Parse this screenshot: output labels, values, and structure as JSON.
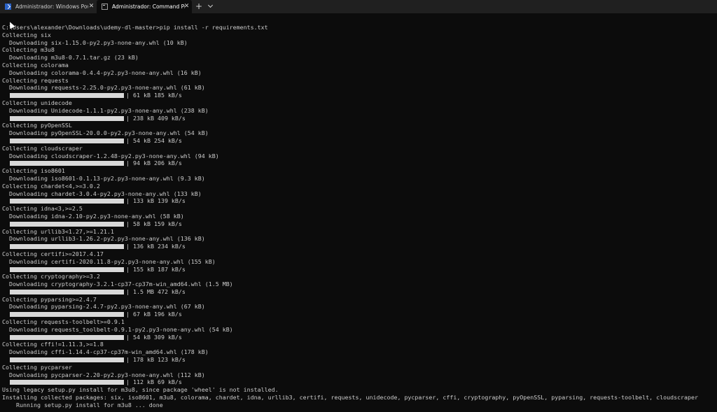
{
  "tabs": [
    {
      "label": "Administrador: Windows Power",
      "close": "✕",
      "icon": "powershell-icon"
    },
    {
      "label": "Administrador: Command Prom",
      "close": "✕",
      "icon": "command-prompt-icon"
    }
  ],
  "new_tab": "+",
  "colors": {
    "background": "#0c0c0c",
    "text": "#cccccc",
    "progress": "#d8d8d8",
    "tabbar": "#202020"
  },
  "console": {
    "lines": [
      {
        "text": "C:\\Users\\alexander\\Downloads\\udemy-dl-master>pip install -r requirements.txt"
      },
      {
        "text": "Collecting six"
      },
      {
        "text": "  Downloading six-1.15.0-py2.py3-none-any.whl (10 kB)"
      },
      {
        "text": "Collecting m3u8"
      },
      {
        "text": "  Downloading m3u8-0.7.1.tar.gz (23 kB)"
      },
      {
        "text": "Collecting colorama"
      },
      {
        "text": "  Downloading colorama-0.4.4-py2.py3-none-any.whl (16 kB)"
      },
      {
        "text": "Collecting requests"
      },
      {
        "text": "  Downloading requests-2.25.0-py2.py3-none-any.whl (61 kB)"
      },
      {
        "progress": "| 61 kB 185 kB/s"
      },
      {
        "text": "Collecting unidecode"
      },
      {
        "text": "  Downloading Unidecode-1.1.1-py2.py3-none-any.whl (238 kB)"
      },
      {
        "progress": "| 238 kB 409 kB/s"
      },
      {
        "text": "Collecting pyOpenSSL"
      },
      {
        "text": "  Downloading pyOpenSSL-20.0.0-py2.py3-none-any.whl (54 kB)"
      },
      {
        "progress": "| 54 kB 254 kB/s"
      },
      {
        "text": "Collecting cloudscraper"
      },
      {
        "text": "  Downloading cloudscraper-1.2.48-py2.py3-none-any.whl (94 kB)"
      },
      {
        "progress": "| 94 kB 206 kB/s"
      },
      {
        "text": "Collecting iso8601"
      },
      {
        "text": "  Downloading iso8601-0.1.13-py2.py3-none-any.whl (9.3 kB)"
      },
      {
        "text": "Collecting chardet<4,>=3.0.2"
      },
      {
        "text": "  Downloading chardet-3.0.4-py2.py3-none-any.whl (133 kB)"
      },
      {
        "progress": "| 133 kB 139 kB/s"
      },
      {
        "text": "Collecting idna<3,>=2.5"
      },
      {
        "text": "  Downloading idna-2.10-py2.py3-none-any.whl (58 kB)"
      },
      {
        "progress": "| 58 kB 159 kB/s"
      },
      {
        "text": "Collecting urllib3<1.27,>=1.21.1"
      },
      {
        "text": "  Downloading urllib3-1.26.2-py2.py3-none-any.whl (136 kB)"
      },
      {
        "progress": "| 136 kB 234 kB/s"
      },
      {
        "text": "Collecting certifi>=2017.4.17"
      },
      {
        "text": "  Downloading certifi-2020.11.8-py2.py3-none-any.whl (155 kB)"
      },
      {
        "progress": "| 155 kB 187 kB/s"
      },
      {
        "text": "Collecting cryptography>=3.2"
      },
      {
        "text": "  Downloading cryptography-3.2.1-cp37-cp37m-win_amd64.whl (1.5 MB)"
      },
      {
        "progress": "| 1.5 MB 472 kB/s"
      },
      {
        "text": "Collecting pyparsing>=2.4.7"
      },
      {
        "text": "  Downloading pyparsing-2.4.7-py2.py3-none-any.whl (67 kB)"
      },
      {
        "progress": "| 67 kB 196 kB/s"
      },
      {
        "text": "Collecting requests-toolbelt>=0.9.1"
      },
      {
        "text": "  Downloading requests_toolbelt-0.9.1-py2.py3-none-any.whl (54 kB)"
      },
      {
        "progress": "| 54 kB 309 kB/s"
      },
      {
        "text": "Collecting cffi!=1.11.3,>=1.8"
      },
      {
        "text": "  Downloading cffi-1.14.4-cp37-cp37m-win_amd64.whl (178 kB)"
      },
      {
        "progress": "| 178 kB 123 kB/s"
      },
      {
        "text": "Collecting pycparser"
      },
      {
        "text": "  Downloading pycparser-2.20-py2.py3-none-any.whl (112 kB)"
      },
      {
        "progress": "| 112 kB 69 kB/s"
      },
      {
        "text": "Using legacy setup.py install for m3u8, since package 'wheel' is not installed."
      },
      {
        "text": "Installing collected packages: six, iso8601, m3u8, colorama, chardet, idna, urllib3, certifi, requests, unidecode, pycparser, cffi, cryptography, pyOpenSSL, pyparsing, requests-toolbelt, cloudscraper"
      },
      {
        "text": "    Running setup.py install for m3u8 ... done"
      }
    ]
  }
}
